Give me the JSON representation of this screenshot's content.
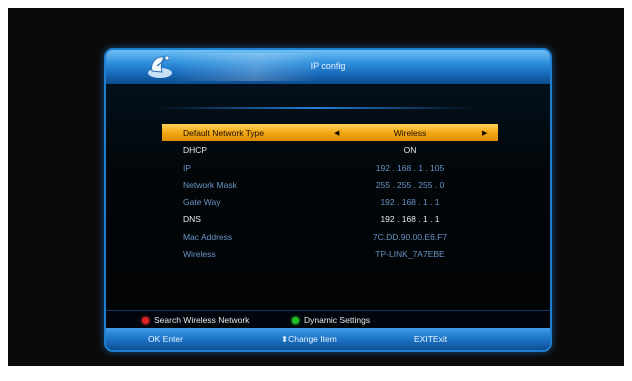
{
  "window": {
    "title": "IP config"
  },
  "settings": [
    {
      "label": "Default Network Type",
      "value": "Wireless",
      "selected": true
    },
    {
      "label": "DHCP",
      "value": "ON"
    },
    {
      "label": "IP",
      "value": "192 . 168 .  1  . 105"
    },
    {
      "label": "Network Mask",
      "value": "255 . 255 . 255 .  0"
    },
    {
      "label": "Gate Way",
      "value": "192 . 168 .  1  .  1"
    },
    {
      "label": "DNS",
      "value": "192 . 168 .  1  .  1"
    },
    {
      "label": "Mac Address",
      "value": "7C.DD.90.00.E6.F7"
    },
    {
      "label": "Wireless",
      "value": "TP-LINK_7A7EBE"
    }
  ],
  "color_actions": {
    "red": {
      "label": "Search Wireless Network",
      "color": "#e02020"
    },
    "green": {
      "label": "Dynamic Settings",
      "color": "#20c020"
    }
  },
  "help": {
    "ok": {
      "key": "OK",
      "label": "Enter"
    },
    "change": {
      "key": "⬍",
      "label": "Change Item"
    },
    "exit": {
      "key": "EXIT",
      "label": "Exit"
    }
  },
  "colors": {
    "accent": "#f3a816",
    "frame": "#1f7fcf",
    "dim_text": "#6a95c7"
  },
  "icons": {
    "logo": "satellite-dish-icon",
    "left": "triangle-left-icon",
    "right": "triangle-right-icon"
  }
}
